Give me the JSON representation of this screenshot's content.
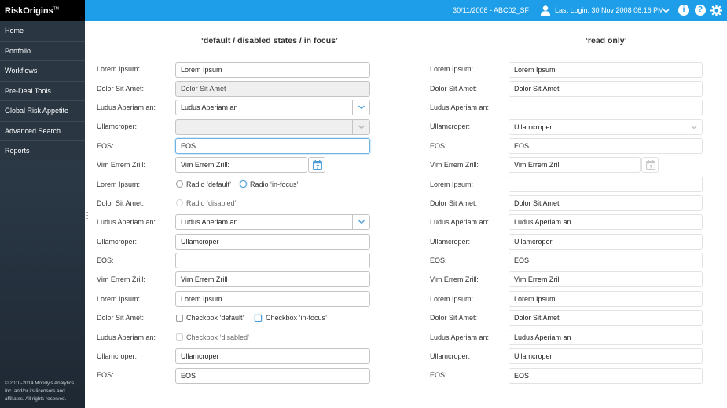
{
  "brand": {
    "name": "RiskOrigins",
    "tm": "TM"
  },
  "nav": [
    "Home",
    "Portfolio",
    "Workflows",
    "Pre-Deal Tools",
    "Global Risk Appetite",
    "Advanced Search",
    "Reports"
  ],
  "copyright": "© 2010-2014 Moody's Analytics, Inc. and/or its licensors and affiliates. All rights reserved.",
  "header": {
    "date_context": "30/11/2008 - ABC02_SF",
    "last_login": "Last Login: 30 Nov 2008 06:16 PM",
    "user_icon": "user-icon",
    "info_icon": "info-icon",
    "help_icon": "help-icon",
    "gear_icon": "gear-icon",
    "info_glyph": "i",
    "help_glyph": "?",
    "accent": "#1e9ee8"
  },
  "left": {
    "title": "‘default / disabled states / in focus’",
    "labels": [
      "Lorem Ipsum:",
      "Dolor Sit Amet:",
      "Ludus Aperiam an:",
      "Ullamcroper:",
      "EOS:",
      "Vim Errem Zrill:",
      "Lorem Ipsum:",
      "Dolor Sit Amet:",
      "Ludus Aperiam an:",
      "Ullamcroper:",
      "EOS:",
      "Vim Errem Zrill:",
      "Lorem Ipsum:",
      "Dolor Sit Amet:",
      "Ludus Aperiam an:",
      "Ullamcroper:",
      "EOS:"
    ],
    "f0": "Lorem Ipsum",
    "f1": "Dolor Sit Amet",
    "f2": "Ludus Aperiam an",
    "f3": "",
    "f4": "EOS",
    "f5": "Vim Errem Zrill:",
    "radio_default": "Radio ‘default’",
    "radio_focus": "Radio ‘in-focus’",
    "radio_disabled": "Radio ‘disabled’",
    "f8": "Ludus Aperiam an",
    "f9": "Ullamcroper",
    "f10": "",
    "f11": "Vim Errem Zrill",
    "f12": "Lorem Ipsum",
    "check_default": "Checkbox ‘default’",
    "check_focus": "Checkbox ‘in-focus’",
    "check_disabled": "Checkbox ‘disabled’",
    "f15": "Ullamcroper",
    "f16": "EOS"
  },
  "right": {
    "title": "‘read only’",
    "labels": [
      "Lorem Ipsum:",
      "Dolor Sit Amet:",
      "Ludus Aperiam an:",
      "Ullamcroper:",
      "EOS:",
      "Vim Errem Zrill:",
      "Lorem Ipsum:",
      "Dolor Sit Amet:",
      "Ludus Aperiam an:",
      "Ullamcroper:",
      "EOS:",
      "Vim Errem Zrill:",
      "Lorem Ipsum:",
      "Dolor Sit Amet:",
      "Ludus Aperiam an:",
      "Ullamcroper:",
      "EOS:"
    ],
    "values": [
      "Lorem Ipsum",
      "Dolor Sit Amet",
      "",
      "Ullamcroper",
      "EOS",
      "Vim Errem Zrill",
      "",
      "Dolor Sit Amet",
      "Ludus Aperiam an",
      "Ullamcroper",
      "EOS",
      "Vim Errem Zrill",
      "Lorem Ipsum",
      "Dolor Sit Amet",
      "Ludus Aperiam an",
      "Ullamcroper",
      "EOS"
    ]
  }
}
